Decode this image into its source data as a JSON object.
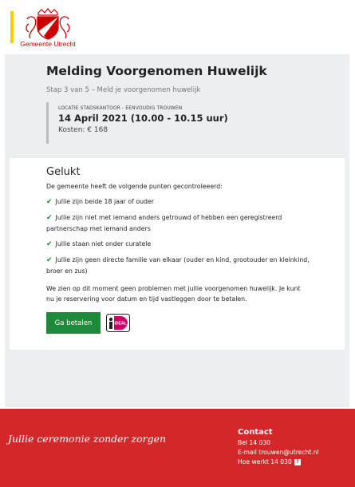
{
  "header": {
    "logo_text": "Gemeente Utrecht",
    "accent_color": "#ffcc00",
    "brand_color": "#cc0000"
  },
  "page": {
    "title": "Melding Voorgenomen Huwelijk",
    "step": "Stap 3 van 5 – Meld je voorgenomen huwelijk"
  },
  "booking": {
    "label": "LOCATIE STADSKANTOOR - EENVOUDIG TROUWEN",
    "date": "14 April 2021 (10.00 - 10.15 uur)",
    "cost": "Kosten: € 168"
  },
  "card": {
    "title": "Gelukt",
    "intro": "De gemeente heeft de volgende punten gecontroleeerd:",
    "checks": [
      "Jullie zijn beide 18 jaar of ouder",
      "Jullie zijn niet met iemand anders getrouwd of hebben een geregistreerd partnerschap met iemand anders",
      "Jullie staan niet onder curatele",
      "Jullie zijn geen directe familie van elkaar (ouder en kind, grootouder en kleinkind, broer en zus)"
    ],
    "text": "We zien op dit moment geen problemen met jullie voorgenomen huwelijk. Je kunt nu je reservering voor datum en tijd vastleggen door te betalen.",
    "pay_label": "Ga betalen",
    "ideal_logo_text": "iDEAL",
    "check_color": "#1c8a3c"
  },
  "footer": {
    "tagline": "Jullie ceremonie zonder zorgen",
    "contact_title": "Contact",
    "phone": "Bel 14 030",
    "email": "E-mail trouwen@utrecht.nl",
    "help": "Hoe werkt 14 030",
    "color": "#d3282a"
  }
}
